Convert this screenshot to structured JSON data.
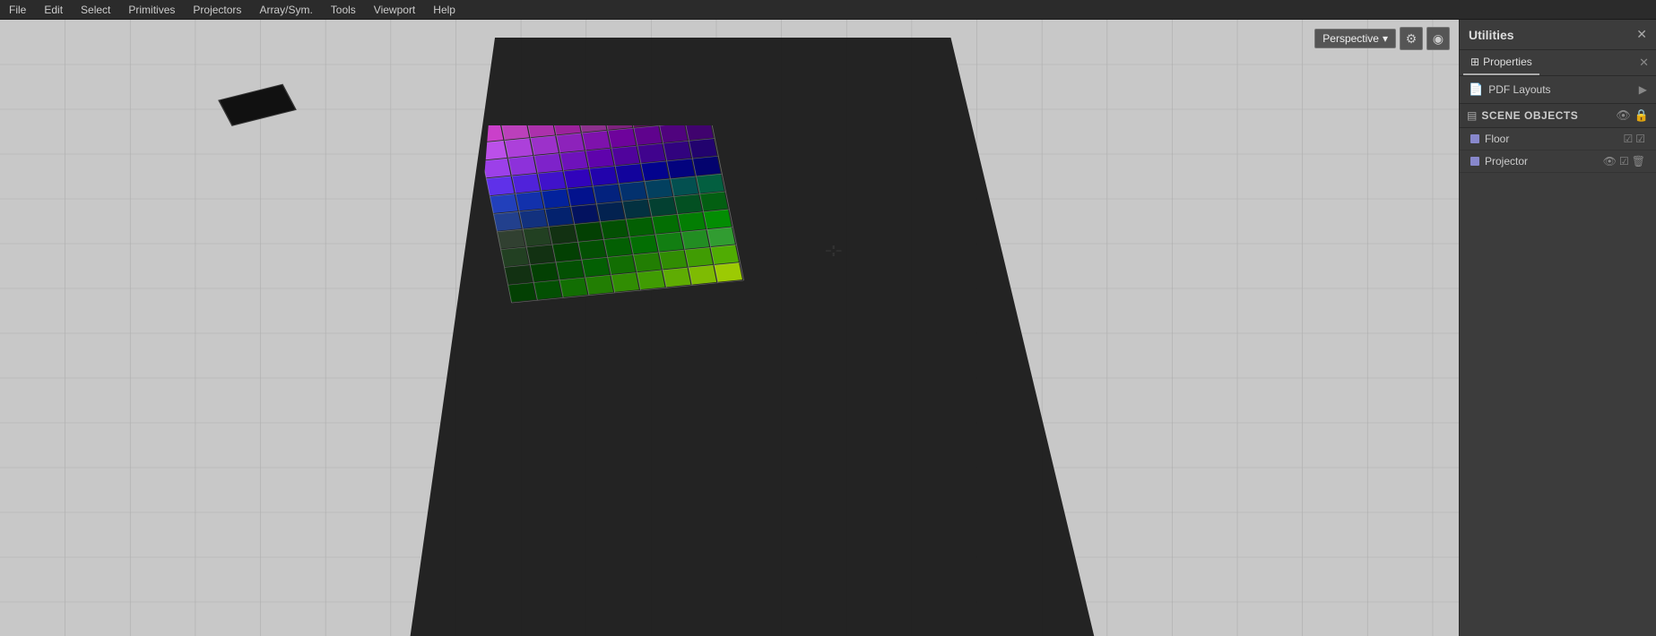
{
  "menubar": {
    "items": [
      "File",
      "Edit",
      "Select",
      "Primitives",
      "Projectors",
      "Array/Sym.",
      "Tools",
      "Viewport",
      "Help"
    ]
  },
  "viewport": {
    "perspective_label": "Perspective",
    "perspective_dropdown_arrow": "▾",
    "settings_icon": "⚙",
    "display_icon": "◉"
  },
  "right_panel": {
    "utilities_title": "Utilities",
    "close_icon": "✕",
    "properties_tab_icon": "⊞",
    "properties_tab_label": "Properties",
    "properties_close": "✕",
    "pdf_layouts_label": "PDF Layouts",
    "pdf_chevron": "▶",
    "scene_objects": {
      "label": "SCENE OBJECTS",
      "eye_icon": "👁",
      "lock_icon": "🔒",
      "items": [
        {
          "name": "Floor",
          "color": "#8888cc",
          "check_icon": "☑",
          "lock_icon": "☑"
        },
        {
          "name": "Projector",
          "color": "#8888cc",
          "eye_icon": "👁",
          "check_icon": "☑",
          "trash_icon": "🗑"
        }
      ]
    }
  }
}
